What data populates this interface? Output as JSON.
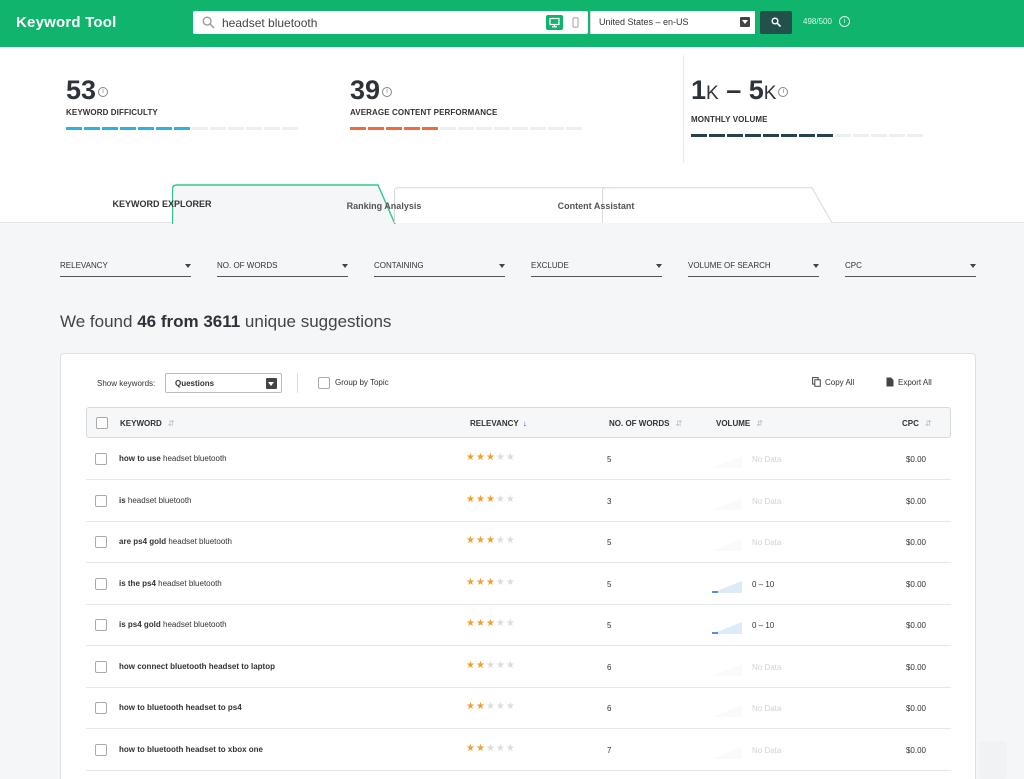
{
  "app": {
    "brand": "Keyword Tool"
  },
  "search": {
    "query": "headset bluetooth",
    "locale": "United States – en-US",
    "quota": "498/500"
  },
  "metrics": {
    "difficulty": {
      "value": "53",
      "label": "KEYWORD DIFFICULTY",
      "fraction": 0.53,
      "color": "#29b6d8"
    },
    "content": {
      "value": "39",
      "label": "AVERAGE CONTENT PERFORMANCE",
      "fraction": 0.39,
      "color": "#f26b3a"
    },
    "volume": {
      "low": "1",
      "low_unit": "K",
      "sep": " – ",
      "high": "5",
      "high_unit": "K",
      "label": "MONTHLY VOLUME",
      "fraction": 0.6,
      "color": "#27424a"
    }
  },
  "tabs": [
    {
      "label": "KEYWORD EXPLORER",
      "active": true
    },
    {
      "label": "Ranking Analysis",
      "active": false
    },
    {
      "label": "Content Assistant",
      "active": false
    }
  ],
  "filters": [
    "RELEVANCY",
    "NO. OF WORDS",
    "CONTAINING",
    "EXCLUDE",
    "VOLUME OF SEARCH",
    "CPC"
  ],
  "summary": {
    "prefix": "We found ",
    "count": "46 from 3611",
    "suffix": " unique suggestions"
  },
  "toolbar": {
    "show_label": "Show keywords:",
    "show_value": "Questions",
    "group_label": "Group by Topic",
    "copy_all": "Copy All",
    "export_all": "Export All"
  },
  "table": {
    "headers": {
      "keyword": "KEYWORD",
      "relevancy": "RELEVANCY",
      "words": "NO. OF WORDS",
      "volume": "VOLUME",
      "cpc": "CPC"
    },
    "sort_icon": "↓",
    "rows": [
      {
        "bold": "how to use",
        "rest": " headset bluetooth",
        "stars": 3,
        "words": "5",
        "volume": "No Data",
        "has_volume": false,
        "cpc": "$0.00"
      },
      {
        "bold": "is",
        "rest": " headset bluetooth",
        "stars": 3,
        "words": "3",
        "volume": "No Data",
        "has_volume": false,
        "cpc": "$0.00"
      },
      {
        "bold": "are ps4 gold",
        "rest": " headset bluetooth",
        "stars": 3,
        "words": "5",
        "volume": "No Data",
        "has_volume": false,
        "cpc": "$0.00"
      },
      {
        "bold": "is the ps4",
        "rest": " headset bluetooth",
        "stars": 3,
        "words": "5",
        "volume": "0 – 10",
        "has_volume": true,
        "cpc": "$0.00"
      },
      {
        "bold": "is ps4 gold",
        "rest": " headset bluetooth",
        "stars": 3,
        "words": "5",
        "volume": "0 – 10",
        "has_volume": true,
        "cpc": "$0.00"
      },
      {
        "bold": "how connect bluetooth headset to laptop",
        "rest": "",
        "stars": 2,
        "words": "6",
        "volume": "No Data",
        "has_volume": false,
        "cpc": "$0.00"
      },
      {
        "bold": "how to bluetooth headset to ps4",
        "rest": "",
        "stars": 2,
        "words": "6",
        "volume": "No Data",
        "has_volume": false,
        "cpc": "$0.00"
      },
      {
        "bold": "how to bluetooth headset to xbox one",
        "rest": "",
        "stars": 2,
        "words": "7",
        "volume": "No Data",
        "has_volume": false,
        "cpc": "$0.00"
      }
    ]
  }
}
